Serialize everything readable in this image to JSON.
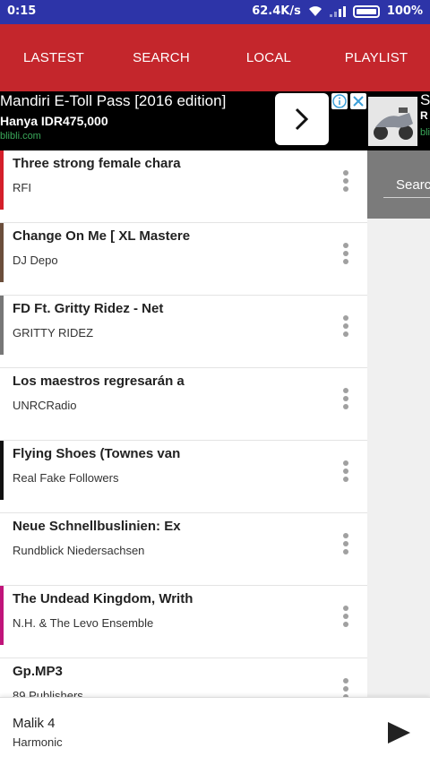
{
  "status": {
    "time": "0:15",
    "speed": "62.4K/s",
    "battery": "100%"
  },
  "tabs": [
    "LASTEST",
    "SEARCH",
    "LOCAL",
    "PLAYLIST"
  ],
  "ad": {
    "title": "Mandiri E-Toll Pass [2016 edition]",
    "price": "Hanya IDR475,000",
    "domain": "blibli.com",
    "right_title": "S",
    "right_sub": "R",
    "right_domain": "bli"
  },
  "tracks": [
    {
      "title": "Three strong female chara",
      "artist": "RFI",
      "strip": "#d41f2a"
    },
    {
      "title": "Change On Me [ XL Mastere",
      "artist": "DJ Depo",
      "strip": "#6b4e3b"
    },
    {
      "title": "FD Ft. Gritty Ridez - Net",
      "artist": "GRITTY RIDEZ",
      "strip": "#777777"
    },
    {
      "title": "Los maestros regresarán a",
      "artist": "UNRCRadio",
      "strip": "#ffffff"
    },
    {
      "title": "Flying Shoes (Townes van",
      "artist": "Real Fake Followers",
      "strip": "#111111"
    },
    {
      "title": "Neue Schnellbuslinien: Ex",
      "artist": "Rundblick Niedersachsen",
      "strip": "#ffffff"
    },
    {
      "title": "The Undead Kingdom, Writh",
      "artist": "N.H. & The Levo Ensemble",
      "strip": "#c0147a"
    },
    {
      "title": "Gp.MP3",
      "artist": "89 Publishers",
      "strip": "#ffffff"
    }
  ],
  "side": {
    "search_label": "Searc"
  },
  "player": {
    "song": "Malik 4",
    "artist": "Harmonic"
  }
}
